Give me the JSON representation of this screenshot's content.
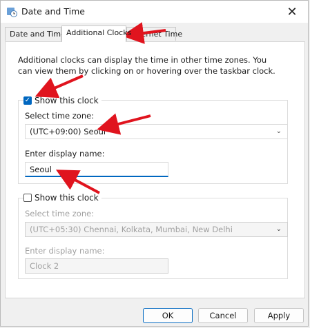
{
  "window": {
    "title": "Date and Time"
  },
  "tabs": [
    {
      "label": "Date and Time"
    },
    {
      "label": "Additional Clocks"
    },
    {
      "label": "Internet Time"
    }
  ],
  "description": "Additional clocks can display the time in other time zones. You can view them by clicking on or hovering over the taskbar clock.",
  "clock1": {
    "show_label": "Show this clock",
    "checked": true,
    "timezone_label": "Select time zone:",
    "timezone_value": "(UTC+09:00) Seoul",
    "name_label": "Enter display name:",
    "name_value": "Seoul"
  },
  "clock2": {
    "show_label": "Show this clock",
    "checked": false,
    "timezone_label": "Select time zone:",
    "timezone_value": "(UTC+05:30) Chennai, Kolkata, Mumbai, New Delhi",
    "name_label": "Enter display name:",
    "name_value": "Clock 2"
  },
  "buttons": {
    "ok": "OK",
    "cancel": "Cancel",
    "apply": "Apply"
  },
  "colors": {
    "accent": "#0067c0",
    "annotation": "#e0141e"
  }
}
